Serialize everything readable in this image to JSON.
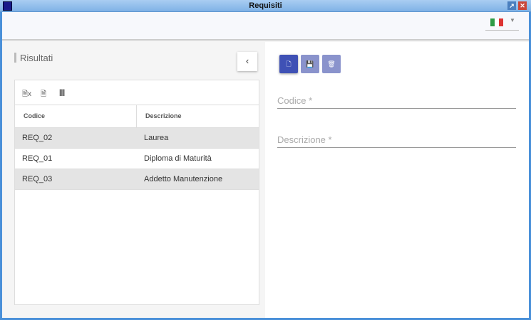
{
  "window": {
    "title": "Requisiti"
  },
  "header": {
    "language": "Italiano"
  },
  "results": {
    "title": "Risultati",
    "back_label": "‹",
    "columns": [
      "Codice",
      "Descrizione"
    ],
    "rows": [
      {
        "code": "REQ_02",
        "desc": "Laurea"
      },
      {
        "code": "REQ_01",
        "desc": "Diploma di Maturità"
      },
      {
        "code": "REQ_03",
        "desc": "Addetto Manutenzione"
      }
    ]
  },
  "form": {
    "code_label": "Codice *",
    "desc_label": "Descrizione *"
  },
  "colors": {
    "primary": "#3f51b5",
    "primary_disabled": "#8a93cc"
  }
}
